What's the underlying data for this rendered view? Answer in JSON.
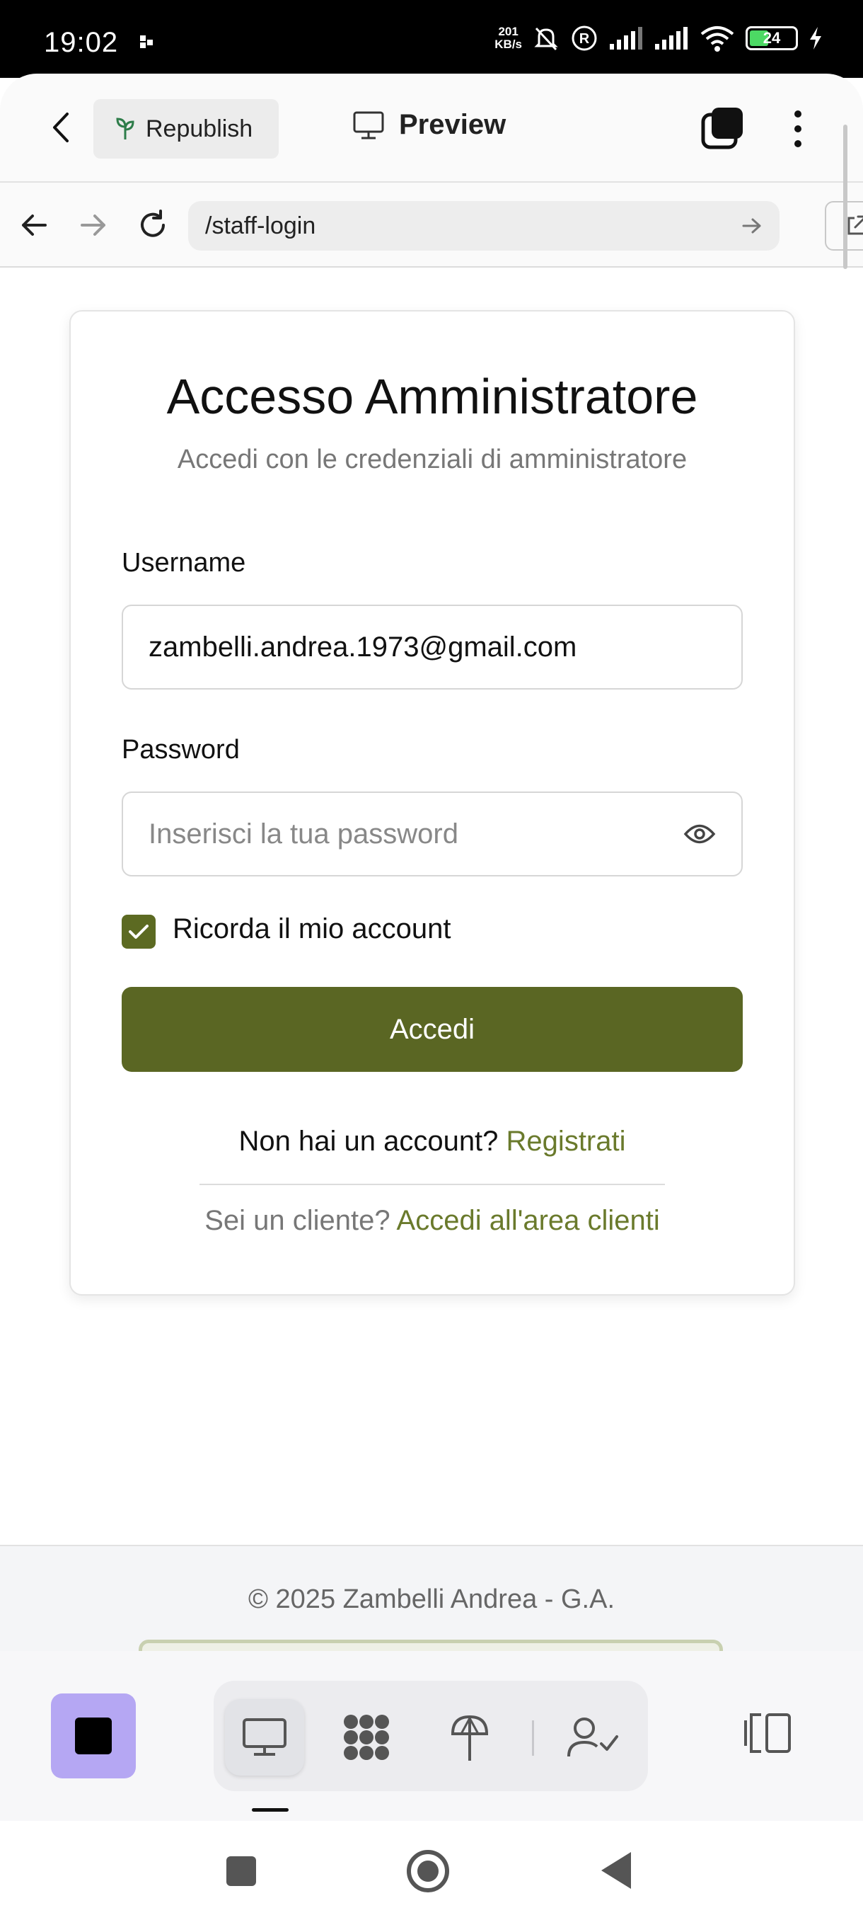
{
  "status_bar": {
    "time": "19:02",
    "net_speed_value": "201",
    "net_speed_unit": "KB/s",
    "battery": "24"
  },
  "app_header": {
    "republish_label": "Republish",
    "preview_label": "Preview"
  },
  "url_bar": {
    "url": "/staff-login"
  },
  "login": {
    "title": "Accesso Amministratore",
    "subtitle": "Accedi con le credenziali di amministratore",
    "username_label": "Username",
    "username_value": "zambelli.andrea.1973@gmail.com",
    "password_label": "Password",
    "password_placeholder": "Inserisci la tua password",
    "remember_label": "Ricorda il mio account",
    "remember_checked": true,
    "submit_label": "Accedi",
    "no_account_text": "Non hai un account?",
    "register_link": "Registrati",
    "client_text": "Sei un cliente?",
    "client_link": "Accedi all'area clienti"
  },
  "footer": {
    "copyright": "© 2025 Zambelli Andrea - G.A."
  },
  "colors": {
    "accent": "#5a6623",
    "link": "#6a7a2c",
    "stop_button": "#b5a7f3"
  },
  "icons": [
    "back-chevron-icon",
    "sprout-icon",
    "monitor-icon",
    "tabs-icon",
    "more-vert-icon",
    "arrow-left-icon",
    "arrow-right-icon",
    "reload-icon",
    "go-arrow-icon",
    "external-link-icon",
    "eye-icon",
    "check-icon",
    "stop-icon",
    "desktop-icon",
    "grid-icon",
    "deploy-icon",
    "user-check-icon",
    "panel-icon"
  ]
}
